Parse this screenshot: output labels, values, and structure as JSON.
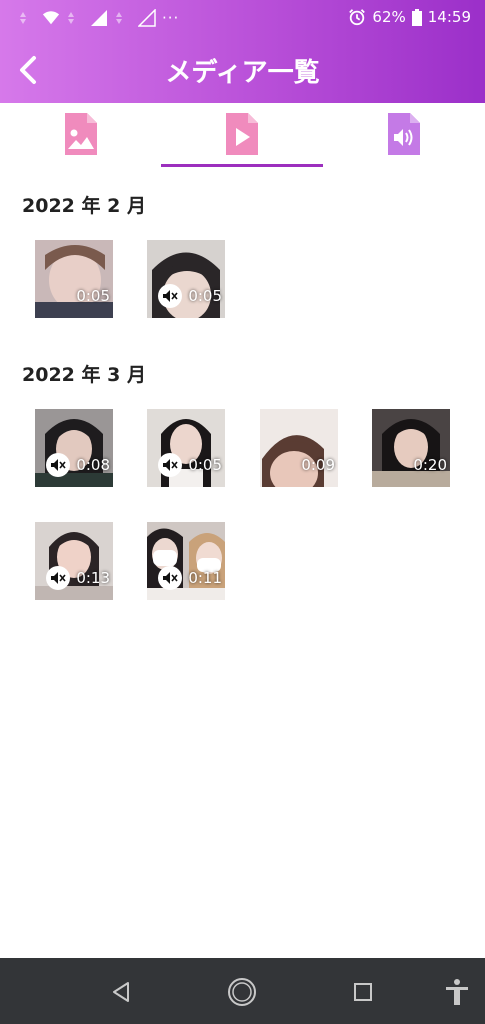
{
  "status_bar": {
    "battery": "62%",
    "time": "14:59",
    "more": "···"
  },
  "header": {
    "title": "メディア一覧"
  },
  "tabs": [
    {
      "name": "image",
      "selected": false
    },
    {
      "name": "video",
      "selected": true
    },
    {
      "name": "audio",
      "selected": false
    }
  ],
  "sections": [
    {
      "title": "2022 年 2 月",
      "items": [
        {
          "duration": "0:05",
          "muted": false
        },
        {
          "duration": "0:05",
          "muted": true
        }
      ]
    },
    {
      "title": "2022 年 3 月",
      "items": [
        {
          "duration": "0:08",
          "muted": true
        },
        {
          "duration": "0:05",
          "muted": true
        },
        {
          "duration": "0:09",
          "muted": false
        },
        {
          "duration": "0:20",
          "muted": false
        },
        {
          "duration": "0:13",
          "muted": true
        },
        {
          "duration": "0:11",
          "muted": true
        }
      ]
    }
  ],
  "colors": {
    "header_start": "#d679ea",
    "header_end": "#9b2fc9",
    "tab_pink": "#f08bbd",
    "tab_purple": "#c47ae6",
    "underline": "#9c2fbe"
  }
}
